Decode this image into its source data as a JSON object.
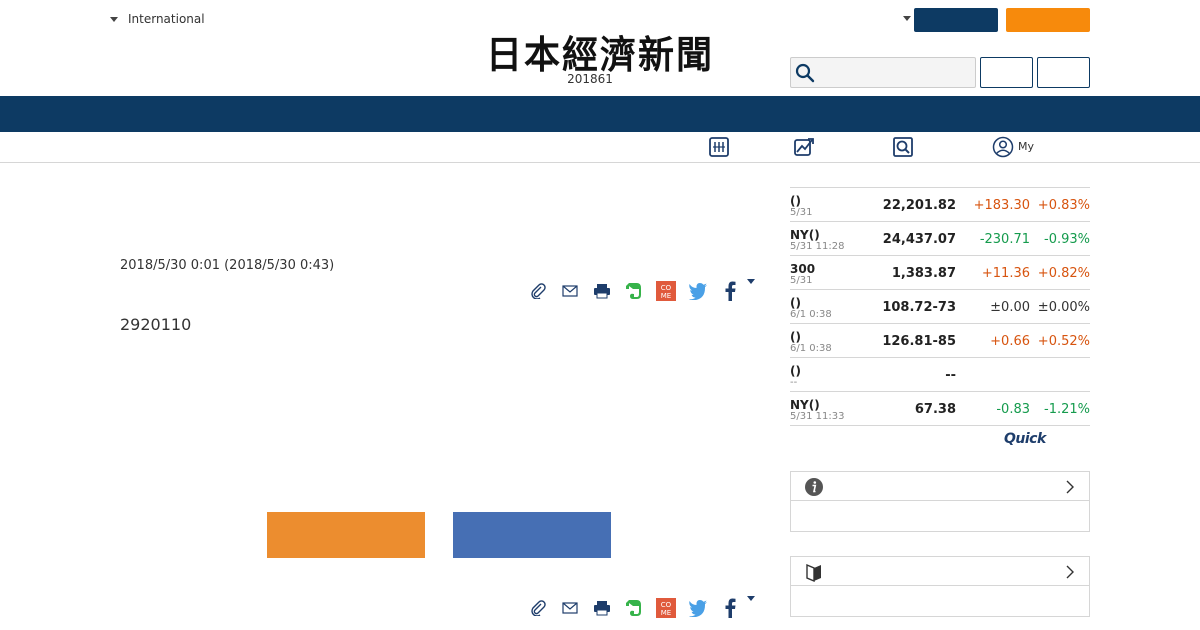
{
  "header": {
    "edition_label": "International",
    "logo_text": "日本經濟新聞",
    "date_text": "201861",
    "search": {
      "placeholder": "",
      "value": ""
    }
  },
  "subnav": {
    "items": [
      {
        "icon": "calendar-grid-icon"
      },
      {
        "icon": "chart-trend-icon"
      },
      {
        "icon": "magnifier-box-icon"
      },
      {
        "icon": "user-circle-icon",
        "label": "My"
      }
    ]
  },
  "article": {
    "published": "2018/5/30 0:01 (2018/5/30 0:43)",
    "body_text": "2920110"
  },
  "share_icons": [
    "clip-icon",
    "mail-icon",
    "print-icon",
    "evernote-icon",
    "come-icon",
    "twitter-icon",
    "facebook-icon",
    "chevron-down-icon"
  ],
  "share_come_text": [
    "CO",
    "ME"
  ],
  "market": {
    "rows": [
      {
        "name": "()",
        "time": "5/31",
        "value": "22,201.82",
        "change": "+183.30",
        "pct": "+0.83%",
        "dir": "up"
      },
      {
        "name": "NY()",
        "time": "5/31 11:28",
        "value": "24,437.07",
        "change": "-230.71",
        "pct": "-0.93%",
        "dir": "down"
      },
      {
        "name": "300",
        "time": "5/31",
        "value": "1,383.87",
        "change": "+11.36",
        "pct": "+0.82%",
        "dir": "up"
      },
      {
        "name": "()",
        "time": "6/1 0:38",
        "value": "108.72-73",
        "change": "±0.00",
        "pct": "±0.00%",
        "dir": "flat"
      },
      {
        "name": "()",
        "time": "6/1 0:38",
        "value": "126.81-85",
        "change": "+0.66",
        "pct": "+0.52%",
        "dir": "up"
      },
      {
        "name": "()",
        "time": "--",
        "value": "--",
        "change": "",
        "pct": "",
        "dir": "flat"
      },
      {
        "name": "NY()",
        "time": "5/31 11:33",
        "value": "67.38",
        "change": "-0.83",
        "pct": "-1.21%",
        "dir": "down"
      }
    ],
    "source_logo": "Quick"
  },
  "panels": [
    {
      "icon": "info-circle-icon"
    },
    {
      "icon": "beginner-mark-icon"
    }
  ],
  "colors": {
    "navy": "#0d3a63",
    "orange": "#f78a0c",
    "up": "#d7540f",
    "down": "#159b4d",
    "ad_orange": "#ec8d2f",
    "ad_blue": "#466fb4"
  }
}
